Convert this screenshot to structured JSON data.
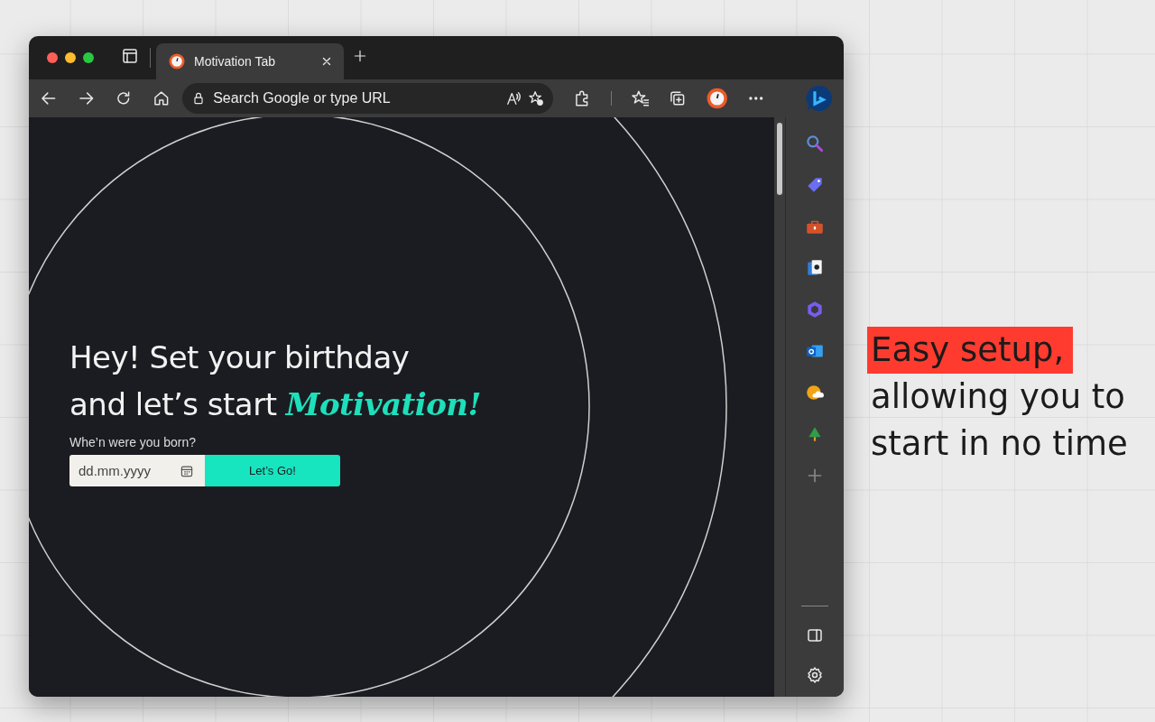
{
  "tab": {
    "title": "Motivation Tab",
    "selected": true
  },
  "address_bar": {
    "placeholder": "Search Google or type URL"
  },
  "page": {
    "heading_line_1": "Hey! Set your birthday",
    "heading_line_2": "and let’s start *Motivation!*",
    "field_label": "Whe’n were you born?",
    "date_field": {
      "placeholder": "dd.mm.yyyy"
    },
    "submit_button": "Let’s Go!"
  },
  "promo": {
    "highlight": "Easy setup,",
    "text": "allowing you to start in no time"
  }
}
